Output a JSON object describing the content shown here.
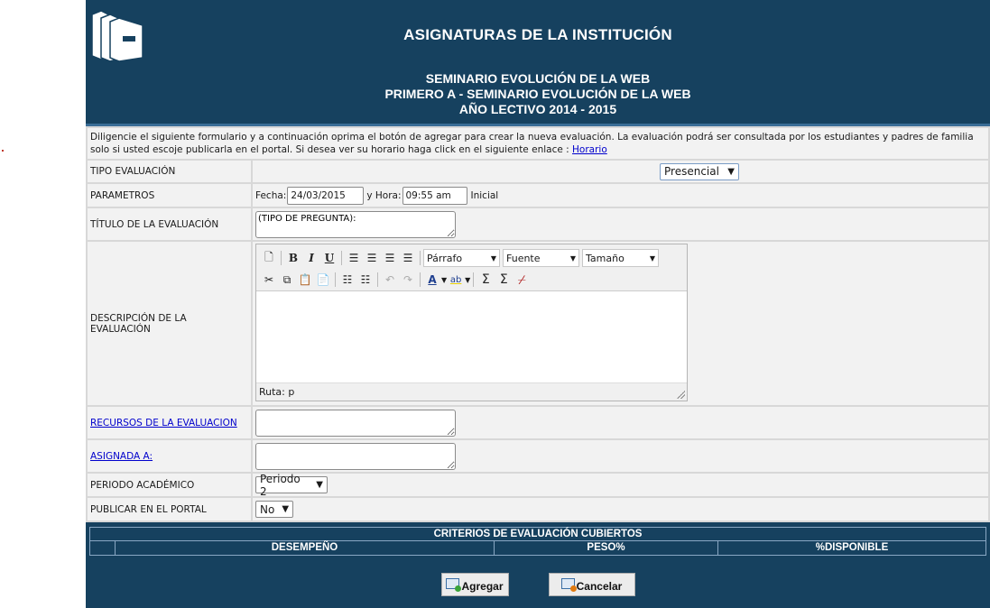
{
  "header": {
    "title": "ASIGNATURAS DE LA INSTITUCIÓN",
    "line1": "SEMINARIO EVOLUCIÓN DE LA WEB",
    "line2": "PRIMERO A - SEMINARIO EVOLUCIÓN DE LA WEB",
    "line3": "AÑO LECTIVO 2014 - 2015"
  },
  "intro": {
    "text": "Diligencie el siguiente formulario y a continuación oprima el botón de agregar para crear la nueva evaluación. La evaluación podrá ser consultada por los estudiantes y padres de familia solo si usted escoje publicarla en el portal. Si desea ver su horario haga click en el siguiente enlace : ",
    "link": "Horario"
  },
  "form": {
    "tipo": {
      "label": "TIPO EVALUACIÓN",
      "value": "Presencial"
    },
    "parametros": {
      "label": "PARAMETROS",
      "fecha_label": "Fecha:",
      "fecha": "24/03/2015",
      "hora_label": "y Hora:",
      "hora": "09:55 am",
      "inicial": "Inicial"
    },
    "titulo": {
      "label": "TÍTULO DE LA EVALUACIÓN",
      "value": "(TIPO DE PREGUNTA):"
    },
    "descripcion": {
      "label": "DESCRIPCIÓN DE LA EVALUACIÓN",
      "format": "Párrafo",
      "font": "Fuente",
      "size": "Tamaño",
      "path": "Ruta: p"
    },
    "recursos": {
      "label": "RECURSOS DE LA EVALUACION"
    },
    "asignada": {
      "label": "ASIGNADA A:"
    },
    "periodo": {
      "label": "PERIODO ACADÉMICO",
      "value": "Periodo 2"
    },
    "publicar": {
      "label": "PUBLICAR EN EL PORTAL",
      "value": "No"
    }
  },
  "criterios": {
    "title": "CRITERIOS DE EVALUACIÓN CUBIERTOS",
    "columns": [
      "",
      "DESEMPEÑO",
      "PESO%",
      "%DISPONIBLE"
    ]
  },
  "actions": {
    "add": "Agregar",
    "cancel": "Cancelar"
  },
  "colors": {
    "header_bg": "#16415f",
    "link": "#0000cc",
    "row_bg": "#f2f2f2"
  }
}
